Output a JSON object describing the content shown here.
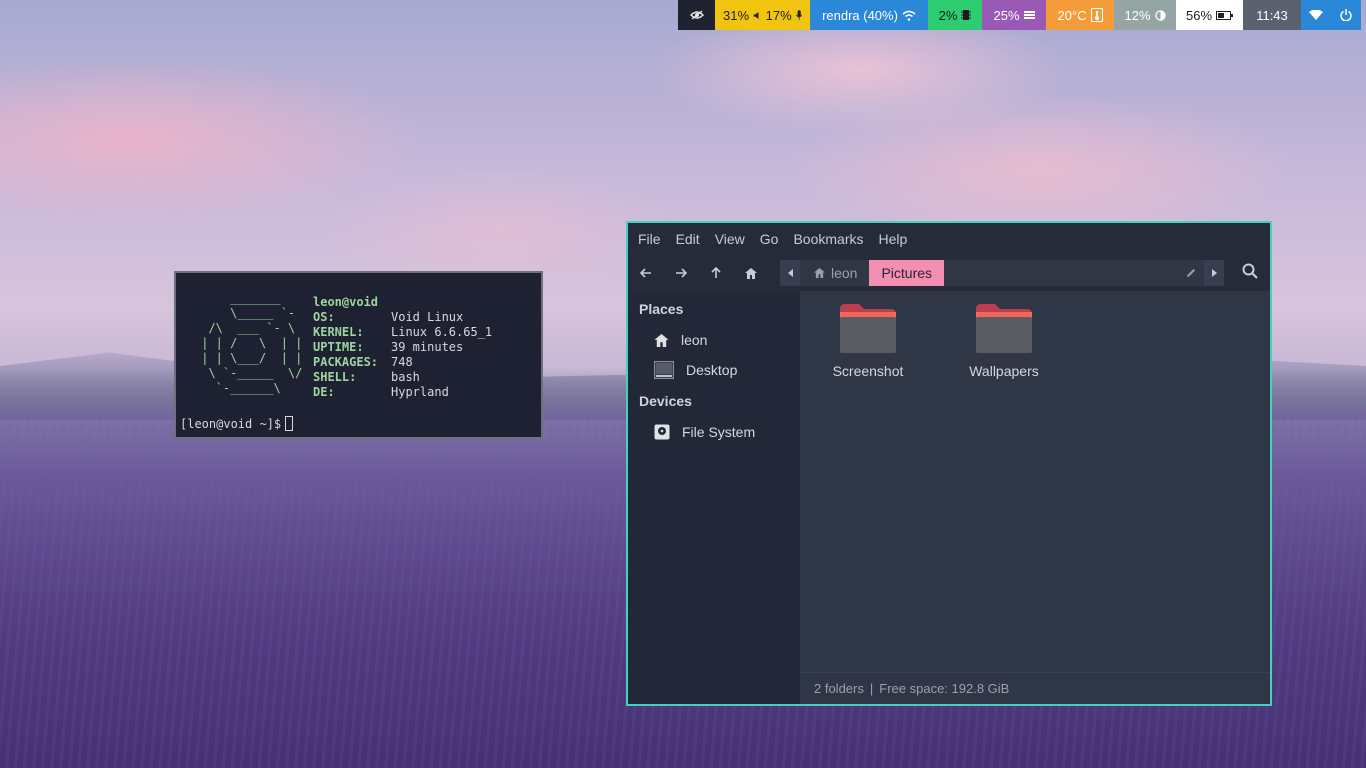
{
  "topbar": {
    "modules": [
      {
        "id": "idle",
        "text": "",
        "icon": "eye-icon",
        "bg": "#1f2230",
        "fg": "#e8e8e8"
      },
      {
        "id": "audio",
        "text": "31%",
        "text2": "17%",
        "icon": "speaker-icon",
        "icon2": "mic-icon",
        "bg": "#f1c40f",
        "fg": "#222222"
      },
      {
        "id": "network",
        "text": "rendra (40%)",
        "icon": "wifi-icon",
        "bg": "#2b88d8",
        "fg": "#ffffff"
      },
      {
        "id": "cpu",
        "text": "2%",
        "icon": "chip-icon",
        "bg": "#2ecc71",
        "fg": "#1a1a1a"
      },
      {
        "id": "memory",
        "text": "25%",
        "icon": "memory-icon",
        "bg": "#9b59b6",
        "fg": "#ffffff"
      },
      {
        "id": "temperature",
        "text": "20°C",
        "icon": "thermometer-icon",
        "bg": "#f39c39",
        "fg": "#ffffff"
      },
      {
        "id": "backlight",
        "text": "12%",
        "icon": "brightness-icon",
        "bg": "#95a5a6",
        "fg": "#ffffff"
      },
      {
        "id": "battery",
        "text": "56%",
        "icon": "battery-icon",
        "bg": "#ffffff",
        "fg": "#222222"
      },
      {
        "id": "clock",
        "text": "11:43",
        "icon": "",
        "bg": "#5a6270",
        "fg": "#ffffff"
      },
      {
        "id": "wifi-applet",
        "text": "",
        "icon": "wifi-signal-icon",
        "bg": "#2b88d8",
        "fg": "#ffffff"
      },
      {
        "id": "power",
        "text": "",
        "icon": "power-icon",
        "bg": "#2b88d8",
        "fg": "#ffffff"
      }
    ]
  },
  "terminal": {
    "user_host": "leon@void",
    "info": [
      {
        "key": "OS:",
        "value": "Void Linux"
      },
      {
        "key": "KERNEL:",
        "value": "Linux 6.6.65_1"
      },
      {
        "key": "UPTIME:",
        "value": "39 minutes"
      },
      {
        "key": "PACKAGES:",
        "value": "748"
      },
      {
        "key": "SHELL:",
        "value": "bash"
      },
      {
        "key": "DE:",
        "value": "Hyprland"
      }
    ],
    "prompt": "[leon@void ~]$",
    "logo_color": "#9ed49e"
  },
  "filemanager": {
    "menu": [
      "File",
      "Edit",
      "View",
      "Go",
      "Bookmarks",
      "Help"
    ],
    "path": {
      "home": "leon",
      "current": "Pictures"
    },
    "places_heading": "Places",
    "places": [
      {
        "label": "leon",
        "icon": "home-icon"
      },
      {
        "label": "Desktop",
        "icon": "desktop-icon"
      }
    ],
    "devices_heading": "Devices",
    "devices": [
      {
        "label": "File System",
        "icon": "drive-icon"
      }
    ],
    "folders": [
      "Screenshot",
      "Wallpapers"
    ],
    "status": {
      "count": "2 folders",
      "separator": "|",
      "free": "Free space: 192.8 GiB"
    },
    "accent": "#43d1c0",
    "highlight": "#f48fb1"
  }
}
